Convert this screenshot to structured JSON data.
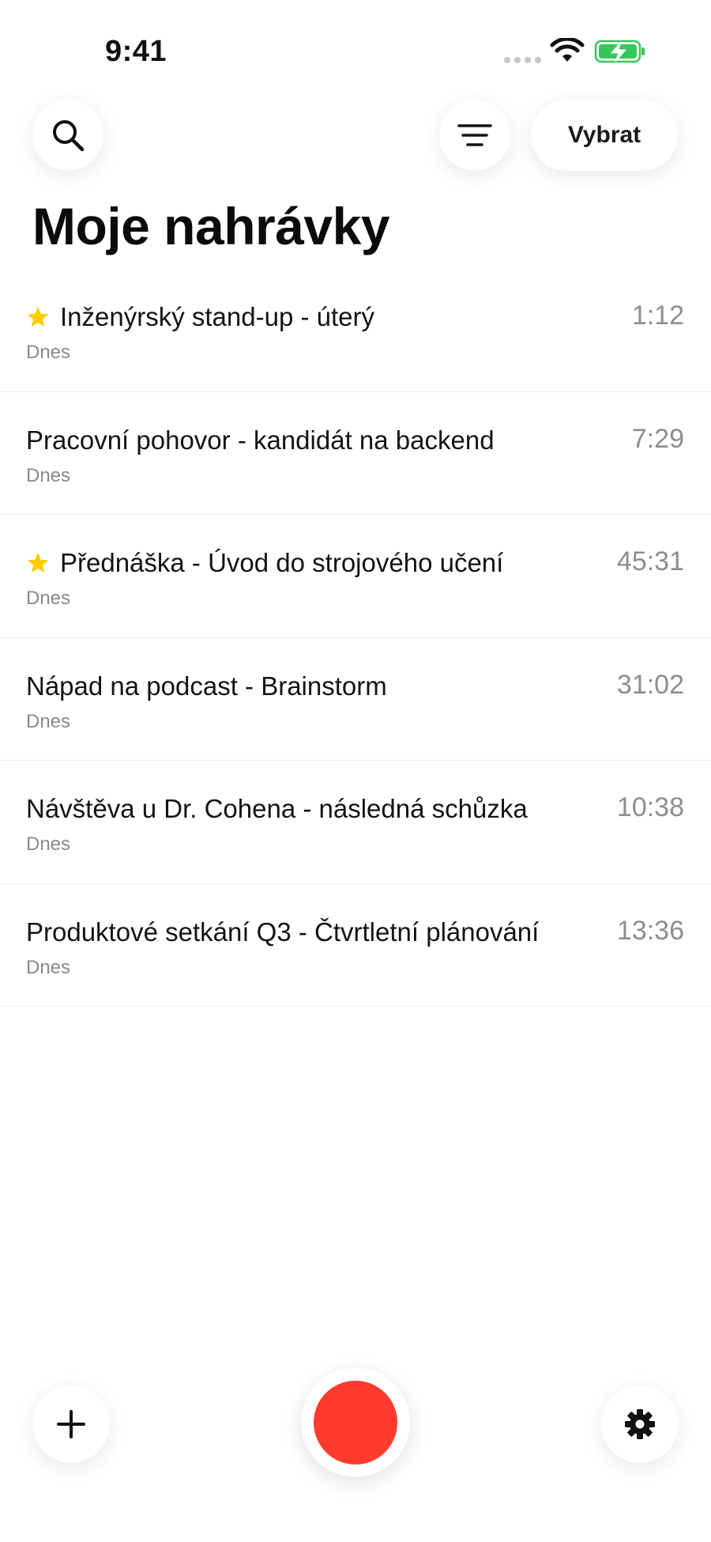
{
  "status_bar": {
    "time": "9:41",
    "icons": [
      "signal-dots-icon",
      "wifi-icon",
      "battery-charging-icon"
    ],
    "battery_color": "#34c759"
  },
  "header": {
    "search_icon": "search-icon",
    "filter_icon": "filter-lines-icon",
    "select_label": "Vybrat"
  },
  "page": {
    "title": "Moje nahrávky"
  },
  "recordings": [
    {
      "title": "Inženýrský stand-up - úterý",
      "date": "Dnes",
      "duration": "1:12",
      "starred": true
    },
    {
      "title": "Pracovní pohovor - kandidát na backend",
      "date": "Dnes",
      "duration": "7:29",
      "starred": false
    },
    {
      "title": "Přednáška - Úvod do strojového učení",
      "date": "Dnes",
      "duration": "45:31",
      "starred": true
    },
    {
      "title": "Nápad na podcast - Brainstorm",
      "date": "Dnes",
      "duration": "31:02",
      "starred": false
    },
    {
      "title": "Návštěva u Dr. Cohena - následná schůzka",
      "date": "Dnes",
      "duration": "10:38",
      "starred": false
    },
    {
      "title": "Produktové setkání Q3 - Čtvrtletní plánování",
      "date": "Dnes",
      "duration": "13:36",
      "starred": false
    }
  ],
  "bottom_bar": {
    "add_icon": "plus-icon",
    "record_icon": "record-icon",
    "settings_icon": "gear-icon",
    "record_color": "#ff3b30",
    "star_color": "#ffcc00"
  }
}
